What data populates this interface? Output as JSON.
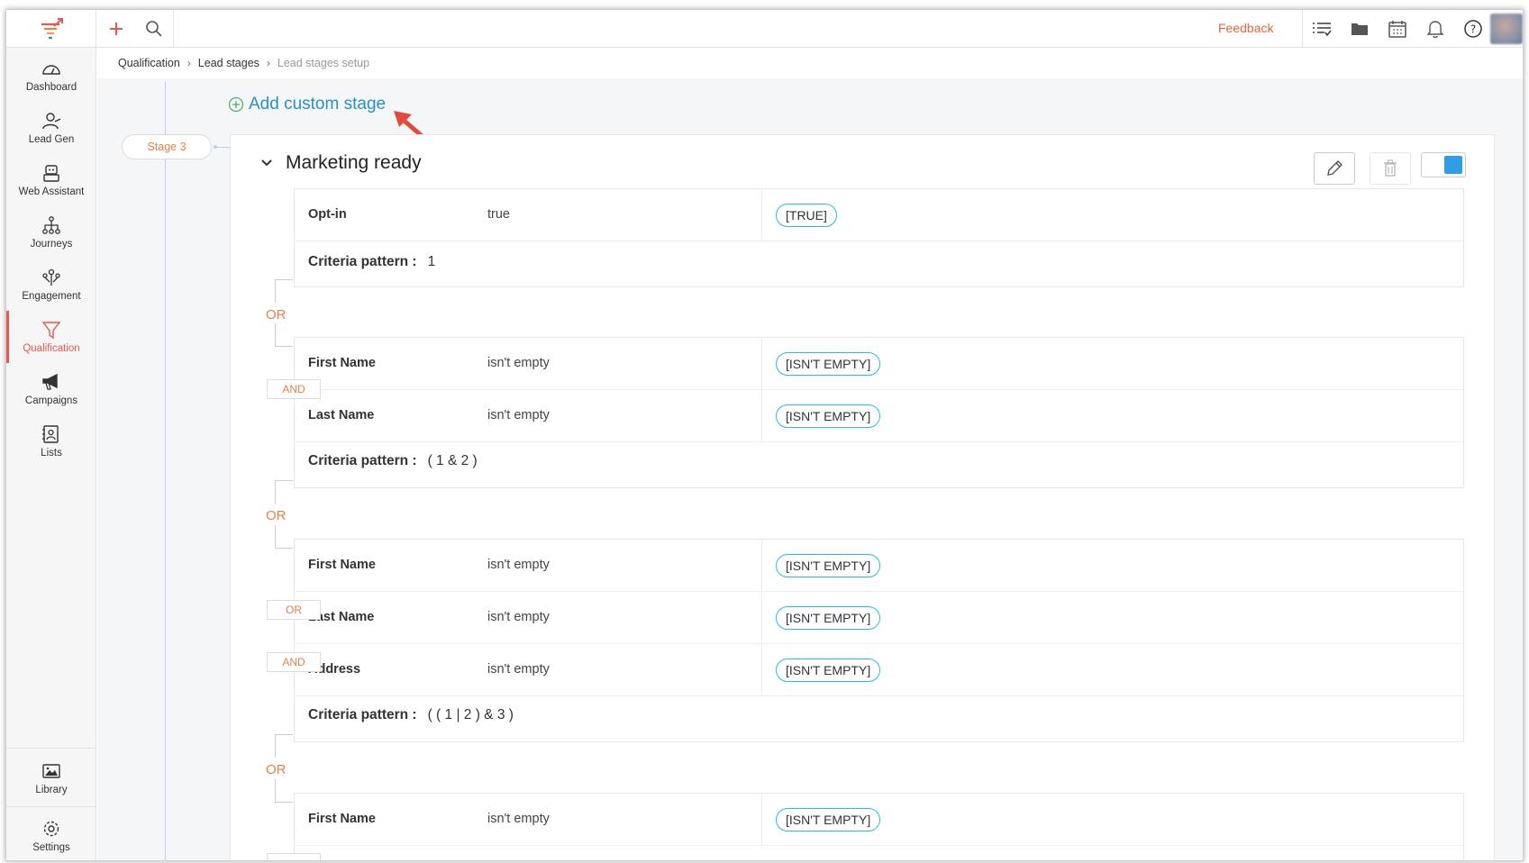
{
  "topbar": {
    "feedback_label": "Feedback"
  },
  "sidebar": {
    "items": [
      {
        "label": "Dashboard",
        "icon": "dashboard-icon"
      },
      {
        "label": "Lead Gen",
        "icon": "lead-gen-icon"
      },
      {
        "label": "Web Assistant",
        "icon": "web-assistant-icon"
      },
      {
        "label": "Journeys",
        "icon": "journeys-icon"
      },
      {
        "label": "Engagement",
        "icon": "engagement-icon"
      },
      {
        "label": "Qualification",
        "icon": "funnel-icon",
        "active": true
      },
      {
        "label": "Campaigns",
        "icon": "megaphone-icon"
      },
      {
        "label": "Lists",
        "icon": "lists-icon"
      }
    ],
    "bottom_items": [
      {
        "label": "Library",
        "icon": "image-icon"
      },
      {
        "label": "Settings",
        "icon": "gear-icon"
      }
    ]
  },
  "breadcrumb": {
    "items": [
      "Qualification",
      "Lead stages",
      "Lead stages setup"
    ]
  },
  "main": {
    "add_stage_label": "Add custom stage",
    "stage_pill": "Stage 3",
    "stage_title": "Marketing ready",
    "toggle_on": true,
    "groups": [
      {
        "rows": [
          {
            "field": "Opt-in",
            "operator": "true",
            "tag": "[TRUE]"
          }
        ],
        "pattern_label": "Criteria pattern :",
        "pattern_value": "1"
      },
      {
        "rows": [
          {
            "field": "First Name",
            "operator": "isn't empty",
            "tag": "[ISN'T EMPTY]"
          },
          {
            "field": "Last Name",
            "operator": "isn't empty",
            "tag": "[ISN'T EMPTY]"
          }
        ],
        "joins": [
          "AND"
        ],
        "pattern_label": "Criteria pattern :",
        "pattern_value": "( 1 & 2 )"
      },
      {
        "rows": [
          {
            "field": "First Name",
            "operator": "isn't empty",
            "tag": "[ISN'T EMPTY]"
          },
          {
            "field": "Last Name",
            "operator": "isn't empty",
            "tag": "[ISN'T EMPTY]"
          },
          {
            "field": "Address",
            "operator": "isn't empty",
            "tag": "[ISN'T EMPTY]"
          }
        ],
        "joins": [
          "OR",
          "AND"
        ],
        "pattern_label": "Criteria pattern :",
        "pattern_value": "( ( 1 | 2 ) & 3 )"
      },
      {
        "rows": [
          {
            "field": "First Name",
            "operator": "isn't empty",
            "tag": "[ISN'T EMPTY]"
          }
        ]
      }
    ],
    "group_connectors": [
      "OR",
      "OR",
      "OR"
    ]
  },
  "colors": {
    "accent_blue": "#2a8ed1",
    "accent_orange": "#e8804a",
    "active_red": "#e8584f",
    "tag_border": "#2cbdd3",
    "toggle_blue": "#2e9ee6"
  }
}
